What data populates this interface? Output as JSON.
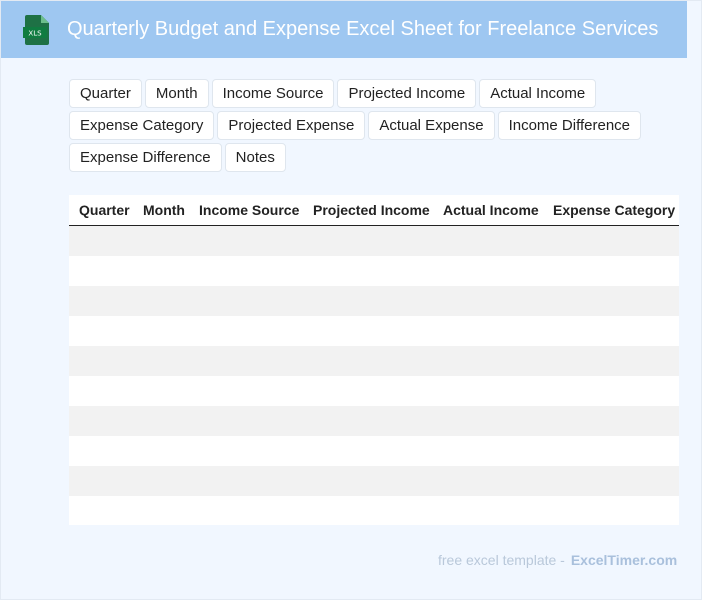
{
  "header": {
    "title": "Quarterly Budget and Expense Excel Sheet for Freelance Services",
    "icon": "xls-file-icon",
    "icon_label": "XLS",
    "background": "#9ec7f1"
  },
  "tags": [
    [
      "Quarter",
      "Month",
      "Income Source",
      "Projected Income",
      "Actual Income"
    ],
    [
      "Expense Category",
      "Projected Expense",
      "Actual Expense",
      "Income Difference"
    ],
    [
      "Expense Difference",
      "Notes"
    ]
  ],
  "table": {
    "columns": [
      "Quarter",
      "Month",
      "Income Source",
      "Projected Income",
      "Actual Income",
      "Expense Category"
    ],
    "row_count": 10
  },
  "footer": {
    "text": "free excel template -",
    "brand": "ExcelTimer.com"
  }
}
